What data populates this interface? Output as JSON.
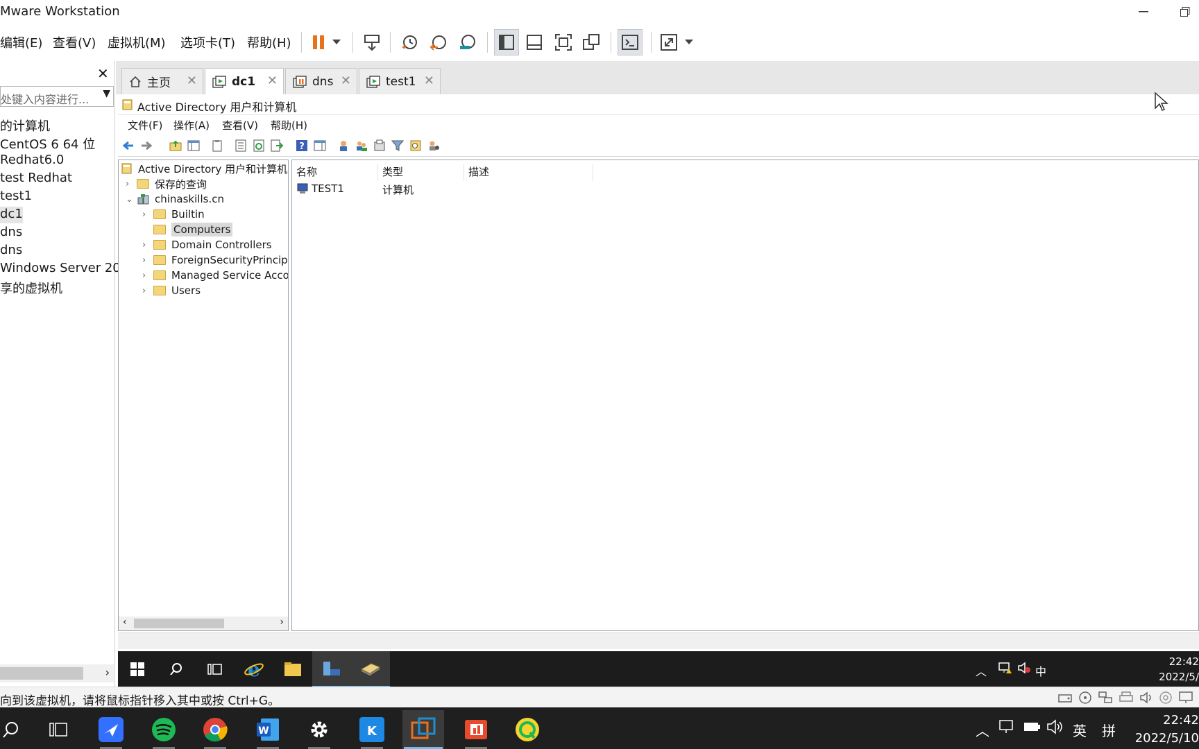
{
  "window": {
    "title": "Mware Workstation"
  },
  "menu": {
    "items": [
      "编辑(E)",
      "查看(V)",
      "虚拟机(M)",
      "选项卡(T)",
      "帮助(H)"
    ]
  },
  "library": {
    "search_placeholder": "处键入内容进行...",
    "items": [
      "的计算机",
      "CentOS 6 64 位",
      "Redhat6.0",
      "test Redhat",
      "test1",
      "dc1",
      "dns",
      "dns",
      "Windows Server 20",
      "享的虚拟机"
    ],
    "selected": "dc1"
  },
  "tabs": [
    {
      "label": "主页",
      "icon": "home-icon"
    },
    {
      "label": "dc1",
      "icon": "vm-running-icon",
      "active": true
    },
    {
      "label": "dns",
      "icon": "vm-paused-icon"
    },
    {
      "label": "test1",
      "icon": "vm-running-icon"
    }
  ],
  "guest": {
    "mmc": {
      "title": "Active Directory 用户和计算机",
      "menu": [
        "文件(F)",
        "操作(A)",
        "查看(V)",
        "帮助(H)"
      ],
      "tree": {
        "root": "Active Directory 用户和计算机 [",
        "saved_queries": "保存的查询",
        "domain": "chinaskills.cn",
        "children": [
          "Builtin",
          "Computers",
          "Domain Controllers",
          "ForeignSecurityPrincipal",
          "Managed Service Accou",
          "Users"
        ],
        "selected": "Computers"
      },
      "list": {
        "columns": [
          "名称",
          "类型",
          "描述"
        ],
        "rows": [
          {
            "name": "TEST1",
            "type": "计算机",
            "description": ""
          }
        ]
      }
    },
    "taskbar": {
      "tray_lang": "中",
      "time": "22:42",
      "date": "2022/5/"
    }
  },
  "statusbar": {
    "text": "向到该虚拟机，请将鼠标指针移入其中或按 Ctrl+G。"
  },
  "host_taskbar": {
    "tray_lang": "英",
    "tray_ime": "拼",
    "time": "22:42",
    "date": "2022/5/10"
  }
}
